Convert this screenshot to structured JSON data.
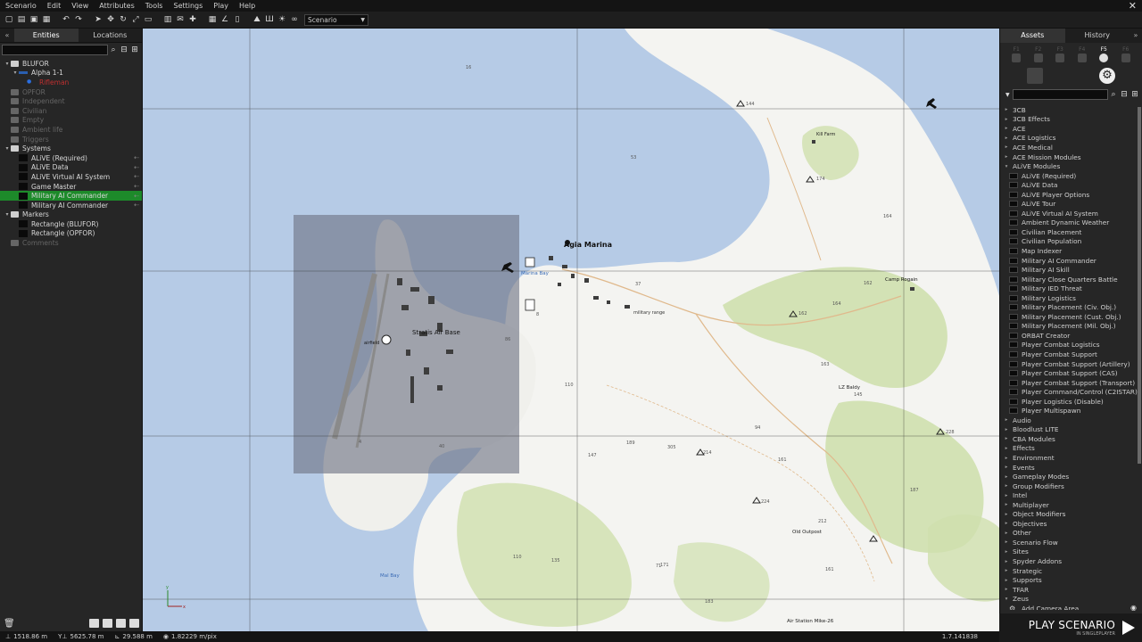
{
  "menu": [
    "Scenario",
    "Edit",
    "View",
    "Attributes",
    "Tools",
    "Settings",
    "Play",
    "Help"
  ],
  "toolbar": {
    "scenario_select": "Scenario"
  },
  "left_panel": {
    "tabs": [
      "Entities",
      "Locations"
    ],
    "tree": [
      {
        "label": "BLUFOR",
        "level": 0,
        "type": "folder",
        "exp": "▾"
      },
      {
        "label": "Alpha 1-1",
        "level": 1,
        "type": "group",
        "exp": "▾"
      },
      {
        "label": "Rifleman",
        "level": 2,
        "type": "unit",
        "exp": ""
      },
      {
        "label": "OPFOR",
        "level": 0,
        "type": "folder-dim",
        "exp": ""
      },
      {
        "label": "Independent",
        "level": 0,
        "type": "folder-dim",
        "exp": ""
      },
      {
        "label": "Civilian",
        "level": 0,
        "type": "folder-dim",
        "exp": ""
      },
      {
        "label": "Empty",
        "level": 0,
        "type": "folder-dim",
        "exp": ""
      },
      {
        "label": "Ambient life",
        "level": 0,
        "type": "folder-dim",
        "exp": ""
      },
      {
        "label": "Triggers",
        "level": 0,
        "type": "folder-dim",
        "exp": ""
      },
      {
        "label": "Systems",
        "level": 0,
        "type": "folder",
        "exp": "▾"
      },
      {
        "label": "ALiVE (Required)",
        "level": 1,
        "type": "module",
        "exp": ""
      },
      {
        "label": "ALiVE Data",
        "level": 1,
        "type": "module",
        "exp": ""
      },
      {
        "label": "ALiVE Virtual AI System",
        "level": 1,
        "type": "module",
        "exp": ""
      },
      {
        "label": "Game Master",
        "level": 1,
        "type": "module",
        "exp": ""
      },
      {
        "label": "Military AI Commander",
        "level": 1,
        "type": "module",
        "exp": "",
        "selected": true
      },
      {
        "label": "Military AI Commander",
        "level": 1,
        "type": "module",
        "exp": ""
      },
      {
        "label": "Markers",
        "level": 0,
        "type": "folder",
        "exp": "▾"
      },
      {
        "label": "Rectangle (BLUFOR)",
        "level": 1,
        "type": "module",
        "exp": ""
      },
      {
        "label": "Rectangle (OPFOR)",
        "level": 1,
        "type": "module",
        "exp": ""
      },
      {
        "label": "Comments",
        "level": 0,
        "type": "folder-dim",
        "exp": ""
      }
    ]
  },
  "right_panel": {
    "tabs": [
      "Assets",
      "History"
    ],
    "fkeys": [
      "F1",
      "F2",
      "F3",
      "F4",
      "F5",
      "F6"
    ],
    "tree_top": [
      "3CB",
      "3CB Effects",
      "ACE",
      "ACE Logistics",
      "ACE Medical",
      "ACE Mission Modules"
    ],
    "tree_expanded": "ALiVE Modules",
    "alive_modules": [
      "ALiVE (Required)",
      "ALiVE Data",
      "ALiVE Player Options",
      "ALiVE Tour",
      "ALiVE Virtual AI System",
      "Ambient Dynamic Weather",
      "Civilian Placement",
      "Civilian Population",
      "Map Indexer",
      "Military AI Commander",
      "Military AI Skill",
      "Military Close Quarters Battle",
      "Military IED Threat",
      "Military Logistics",
      "Military Placement (Civ. Obj.)",
      "Military Placement (Cust. Obj.)",
      "Military Placement (Mil. Obj.)",
      "ORBAT Creator",
      "Player Combat Logistics",
      "Player Combat Support",
      "Player Combat Support (Artillery)",
      "Player Combat Support (CAS)",
      "Player Combat Support (Transport)",
      "Player Command/Control (C2ISTAR)",
      "Player Logistics (Disable)",
      "Player Multispawn"
    ],
    "tree_bottom": [
      "Audio",
      "Bloodlust LITE",
      "CBA Modules",
      "Effects",
      "Environment",
      "Events",
      "Gameplay Modes",
      "Group Modifiers",
      "Intel",
      "Multiplayer",
      "Object Modifiers",
      "Objectives",
      "Other",
      "Scenario Flow",
      "Sites",
      "Spyder Addons",
      "Strategic",
      "Supports",
      "TFAR",
      "Zeus"
    ],
    "zeus_child": "Add Camera Area"
  },
  "play": {
    "label": "PLAY SCENARIO",
    "sub": "IN SINGLEPLAYER"
  },
  "status": {
    "x": "1518.86 m",
    "y": "5625.78 m",
    "z": "29.588 m",
    "scale": "1.82229 m/pix",
    "version": "1.7.141838"
  },
  "map": {
    "labels": {
      "agia_marina": "Agia Marina",
      "marina_bay": "Marina Bay",
      "stratis_air_base": "Stratis Air Base",
      "airfield": "airfield",
      "military_range": "military range",
      "kill_farm": "Kill Farm",
      "camp_rogain": "Camp Rogain",
      "lz_baldy": "LZ Baldy",
      "old_outpost": "Old Outpost",
      "air_station_mike": "Air Station Mike-26",
      "mal_bay": "Mal Bay"
    },
    "heights": [
      "144",
      "174",
      "53",
      "164",
      "162",
      "164",
      "162",
      "37",
      "163",
      "110",
      "145",
      "94",
      "189",
      "305",
      "214",
      "147",
      "161",
      "187",
      "224",
      "212",
      "171",
      "161",
      "135",
      "183",
      "228",
      "16",
      "86",
      "40",
      "4",
      "71",
      "110",
      "8"
    ]
  }
}
